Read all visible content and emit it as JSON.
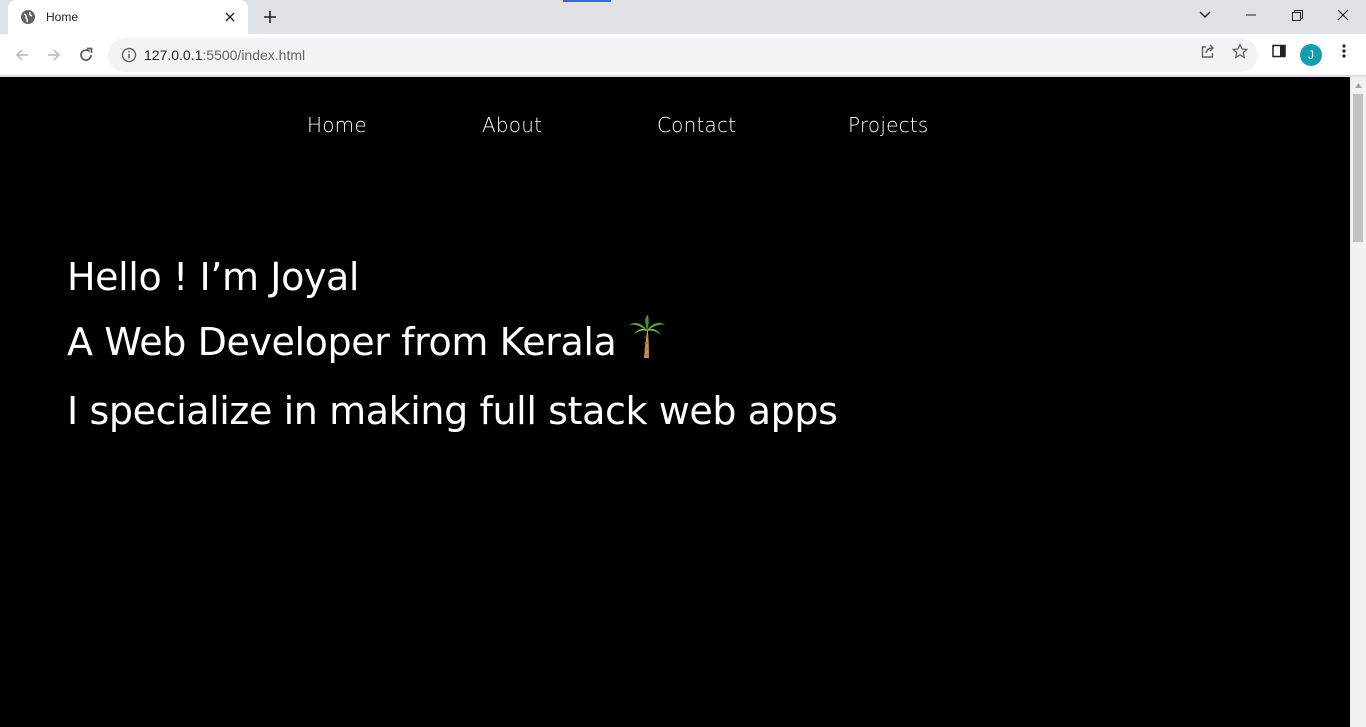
{
  "browser": {
    "tab_title": "Home",
    "url_host": "127.0.0.1",
    "url_path": ":5500/index.html",
    "profile_initial": "J"
  },
  "page": {
    "nav": [
      "Home",
      "About",
      "Contact",
      "Projects"
    ],
    "hero": {
      "line1": "Hello ! I’m Joyal",
      "line2": "A Web Developer from Kerala",
      "line3": "I specialize in making full stack web apps"
    }
  },
  "colors": {
    "page_bg": "#000000",
    "text": "#ffffff",
    "avatar": "#129eaf"
  }
}
